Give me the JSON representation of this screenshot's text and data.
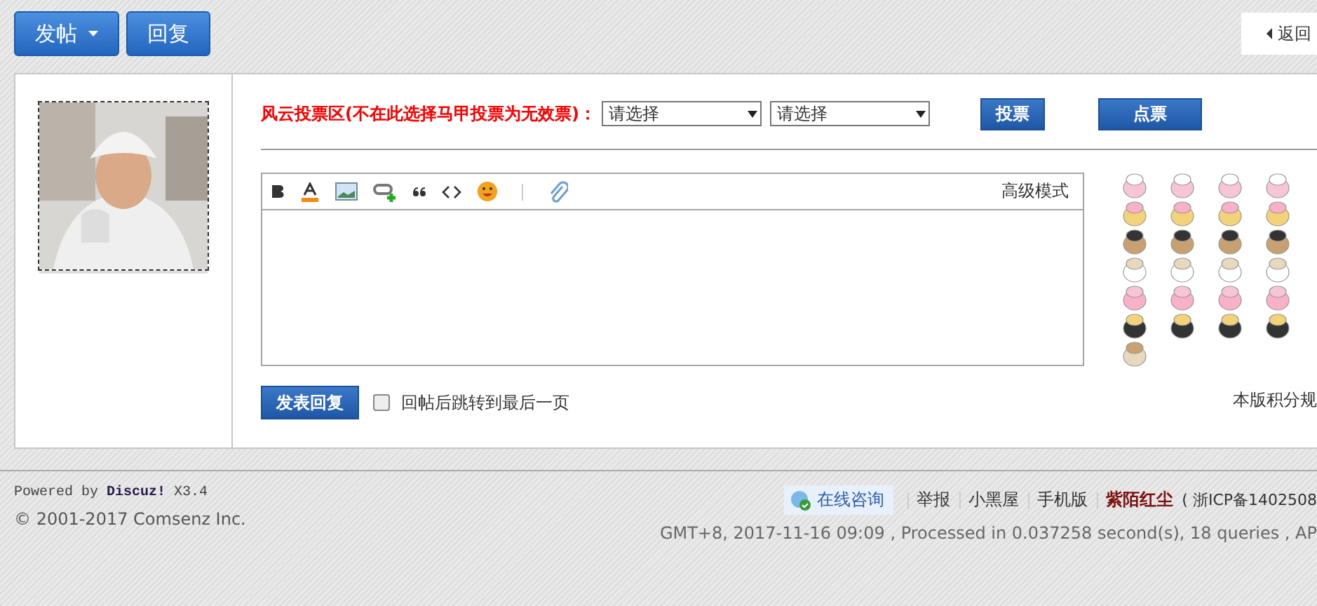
{
  "top_buttons": [
    {
      "label": "发帖",
      "dropdown": true
    },
    {
      "label": "回复",
      "dropdown": false
    }
  ],
  "back_link": {
    "label": "返回"
  },
  "vote": {
    "label": "风云投票区(不在此选择马甲投票为无效票)：",
    "selects": [
      "请选择",
      "请选择"
    ],
    "buttons": [
      {
        "label": "投票",
        "kind": "small"
      },
      {
        "label": "点票",
        "kind": "wide"
      }
    ]
  },
  "editor": {
    "advanced_mode": "高级模式"
  },
  "submit": {
    "label": "发表回复"
  },
  "jump_option": {
    "label": "回帖后跳转到最后一页",
    "checked": false
  },
  "credit_rules": "本版积分规",
  "footer": {
    "powered": "Powered by **Discuz!** X3.4",
    "copyright": "© 2001-2017 Comsenz Inc.",
    "consult": "在线咨询",
    "links": [
      {
        "label": "举报",
        "kind": "plain"
      },
      {
        "label": "小黑屋",
        "kind": "plain"
      },
      {
        "label": "手机版",
        "kind": "plain"
      },
      {
        "label": "紫陌红尘",
        "kind": "site"
      }
    ],
    "icp": "( 浙ICP备1402508",
    "stats": "GMT+8, 2017-11-16 09:09 , Processed in 0.037258 second(s), 18 queries , AP"
  }
}
